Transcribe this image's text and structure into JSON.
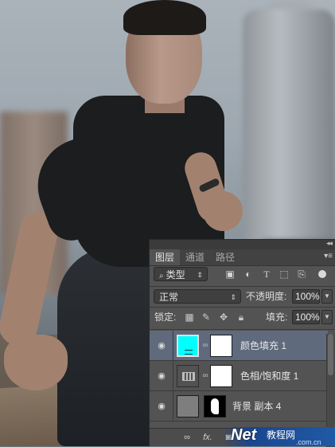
{
  "panel": {
    "collapse_glyph": "◂◂",
    "tabs": [
      {
        "label": "图层",
        "active": true
      },
      {
        "label": "通道",
        "active": false
      },
      {
        "label": "路径",
        "active": false
      }
    ],
    "menu_glyph": "▾≡",
    "filter": {
      "kind": "类型"
    },
    "blend_mode": "正常",
    "opacity_label": "不透明度:",
    "opacity_value": "100%",
    "lock_label": "锁定:",
    "fill_label": "填充:",
    "fill_value": "100%",
    "layers": [
      {
        "name": "颜色填充 1",
        "selected": true,
        "thumb_color": "#00ffff"
      },
      {
        "name": "色相/饱和度 1",
        "selected": false
      },
      {
        "name": "背景 副本 4",
        "selected": false
      }
    ],
    "bottom_icons": [
      "link-icon",
      "fx-icon"
    ],
    "bottom_fx": "fx."
  },
  "watermark": {
    "brand": "Net",
    "cn": "教程网",
    "sub": ".com.cn"
  },
  "colors": {
    "panel_bg": "#535353",
    "selected_layer": "#5f6a7d",
    "fill_thumb": "#00ffff"
  }
}
